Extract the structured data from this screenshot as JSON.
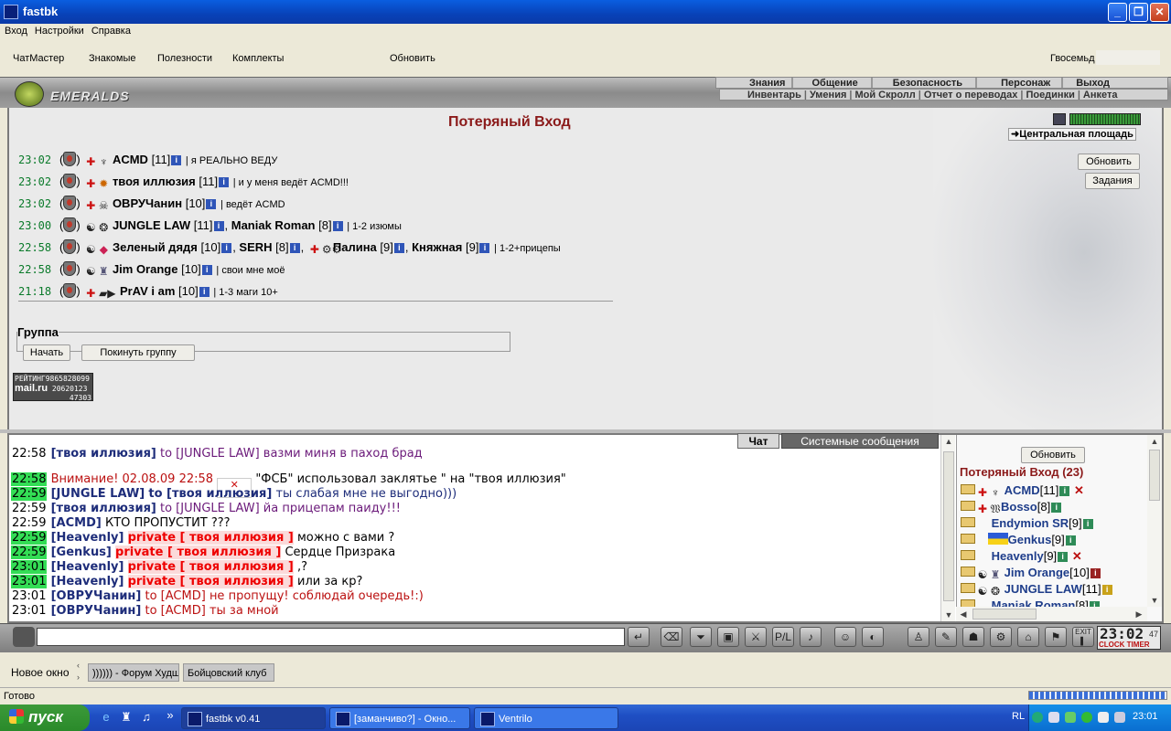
{
  "window": {
    "title": "fastbk",
    "min_icon": "minimize-icon",
    "max_icon": "maximize-icon",
    "close_icon": "close-icon"
  },
  "menu": [
    "Вход",
    "Настройки",
    "Справка"
  ],
  "toolbar": {
    "items": [
      "ЧатМастер",
      "Знакомые",
      "Полезности",
      "Комплекты"
    ],
    "refresh": "Обновить",
    "user": "Гвосемьд"
  },
  "game": {
    "logo": "EMERALDS",
    "nav1": [
      "Знания",
      "Общение",
      "Безопасность",
      "Персонаж",
      "Выход"
    ],
    "nav2": [
      "Инвентарь",
      "Умения",
      "Мой Скролл",
      "Отчет о переводах",
      "Поединки",
      "Анкета"
    ]
  },
  "room": {
    "title": "Потеряный Вход",
    "location": "Центральная площадь",
    "refresh_btn": "Обновить",
    "tasks_btn": "Задания",
    "teams": [
      {
        "time": "23:02",
        "members": [
          {
            "name": "ACMD",
            "level": "[11]"
          }
        ],
        "msg": "| я РЕАЛЬНО ВЕДУ"
      },
      {
        "time": "23:02",
        "members": [
          {
            "name": "твоя иллюзия",
            "level": "[11]"
          }
        ],
        "msg": "| и у меня ведёт ACMD!!!"
      },
      {
        "time": "23:02",
        "members": [
          {
            "name": "ОВРУЧанин",
            "level": "[10]"
          }
        ],
        "msg": "| ведёт ACMD"
      },
      {
        "time": "23:00",
        "members": [
          {
            "name": "JUNGLE LAW",
            "level": "[11]"
          },
          {
            "name": "Maniak Roman",
            "level": "[8]"
          }
        ],
        "msg": "| 1-2 изюмы"
      },
      {
        "time": "22:58",
        "members": [
          {
            "name": "Зеленый дядя",
            "level": "[10]"
          },
          {
            "name": "SERH",
            "level": "[8]"
          },
          {
            "name": "Палина",
            "level": "[9]"
          },
          {
            "name": "Княжная",
            "level": "[9]"
          }
        ],
        "msg": "| 1-2+прицепы"
      },
      {
        "time": "22:58",
        "members": [
          {
            "name": "Jim Orange",
            "level": "[10]"
          }
        ],
        "msg": "| свои мне моё"
      },
      {
        "time": "21:18",
        "members": [
          {
            "name": "PrAV i am",
            "level": "[10]"
          }
        ],
        "msg": "| 1-3 маги 10+"
      }
    ],
    "group": {
      "legend": "Группа",
      "start": "Начать",
      "leave": "Покинуть группу"
    },
    "counter": {
      "line1": "РЕЙТИНГ",
      "val1": "9865828099",
      "brand": "mail.ru",
      "val2": "20620123",
      "val3": "47303"
    }
  },
  "chat": {
    "tabs": [
      "Чат",
      "Системные сообщения"
    ],
    "lines": [
      {
        "time": "22:58",
        "hl": false,
        "from": "[твоя иллюзия]",
        "to": "to [JUNGLE LAW]",
        "text": "вазми миня в паход брад",
        "kind": "purple"
      },
      {
        "time": "22:58",
        "hl": true,
        "warn": "Внимание! 02.08.09 22:58",
        "text": "\"ФСБ\" использовал заклятье \" на \"твоя иллюзия\"",
        "kind": "sys"
      },
      {
        "time": "22:59",
        "hl": true,
        "from": "[JUNGLE LAW]",
        "to": "to [твоя иллюзия]",
        "text": "ты слабая мне не выгодно)))",
        "kind": "navy"
      },
      {
        "time": "22:59",
        "hl": false,
        "from": "[твоя иллюзия]",
        "to": "to [JUNGLE LAW]",
        "text": "йа прицепам паиду!!!",
        "kind": "purple"
      },
      {
        "time": "22:59",
        "hl": false,
        "from": "[ACMD]",
        "text": "КТО ПРОПУСТИТ ???",
        "kind": "plain"
      },
      {
        "time": "22:59",
        "hl": true,
        "from": "[Heavenly]",
        "private": "private [ твоя иллюзия ]",
        "text": "можно с вами ?",
        "kind": "private"
      },
      {
        "time": "22:59",
        "hl": true,
        "from": "[Genkus]",
        "private": "private [ твоя иллюзия ]",
        "text": "Сердце Призрака",
        "kind": "private"
      },
      {
        "time": "23:01",
        "hl": true,
        "from": "[Heavenly]",
        "private": "private [ твоя иллюзия ]",
        "text": ",?",
        "kind": "private"
      },
      {
        "time": "23:01",
        "hl": true,
        "from": "[Heavenly]",
        "private": "private [ твоя иллюзия ]",
        "text": "или за кр?",
        "kind": "private"
      },
      {
        "time": "23:01",
        "hl": false,
        "from": "[ОВРУЧанин]",
        "to": "to [ACMD]",
        "text": "не пропущу! соблюдай очередь!:)",
        "kind": "red"
      },
      {
        "time": "23:01",
        "hl": false,
        "from": "[ОВРУЧанин]",
        "to": "to [ACMD]",
        "text": "ты за мной",
        "kind": "red"
      }
    ]
  },
  "userlist": {
    "refresh": "Обновить",
    "title": "Потеряный Вход (23)",
    "users": [
      {
        "name": "ACMD",
        "level": "[11]",
        "kick": true
      },
      {
        "name": "Bosso",
        "level": "[8]",
        "kick": false
      },
      {
        "name": "Endymion SR",
        "level": "[9]",
        "kick": false
      },
      {
        "name": "Genkus",
        "level": "[9]",
        "kick": false
      },
      {
        "name": "Heavenly",
        "level": "[9]",
        "kick": true
      },
      {
        "name": "Jim Orange",
        "level": "[10]",
        "kick": false
      },
      {
        "name": "JUNGLE LAW",
        "level": "[11]",
        "kick": false
      },
      {
        "name": "Maniak Roman",
        "level": "[8]",
        "kick": false
      }
    ]
  },
  "clock": {
    "time": "23:02",
    "sub": "47",
    "labels": "CLOCK TIMER"
  },
  "browser": {
    "new_window": "Новое окно",
    "tabs": [
      ")))))) - Форум Худших",
      "Бойцовский клуб"
    ],
    "status": "Готово"
  },
  "taskbar": {
    "start": "пуск",
    "tasks": [
      "fastbk v0.41",
      "[заманчиво?] - Окно...",
      "Ventrilo"
    ],
    "lang": "RL",
    "time": "23:01"
  }
}
